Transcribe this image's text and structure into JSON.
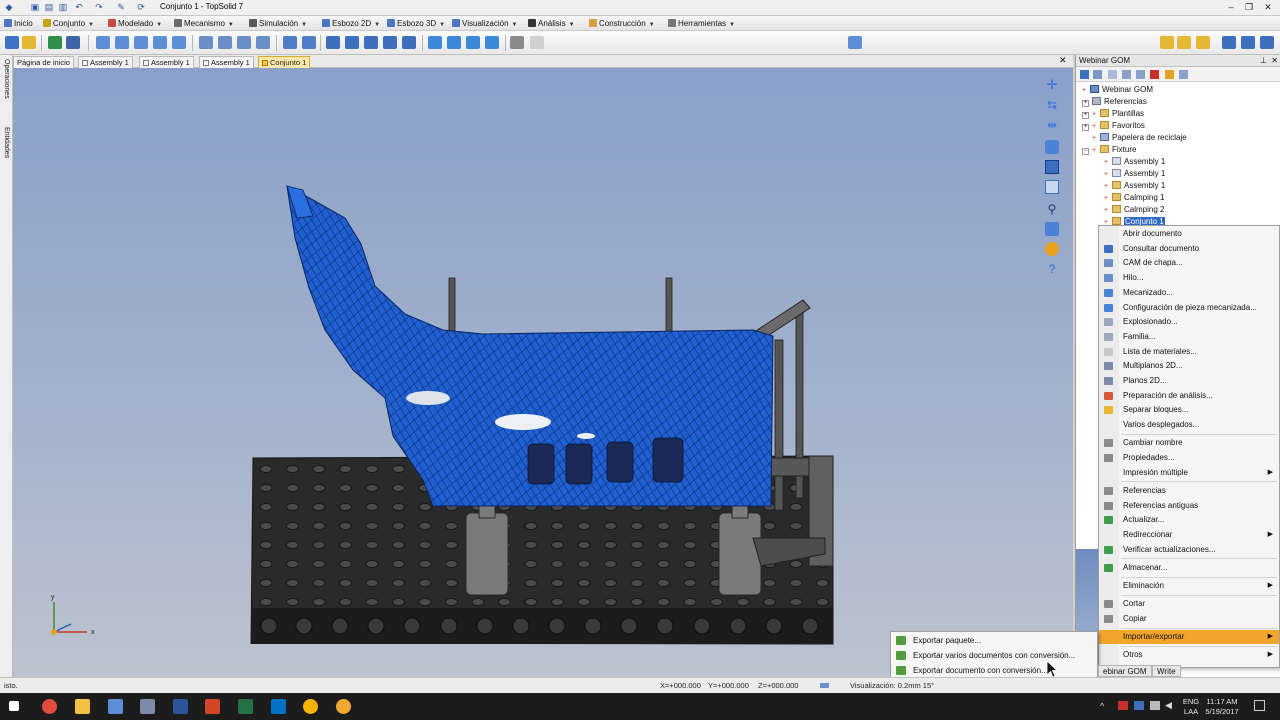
{
  "window": {
    "title": "Conjunto 1 - TopSolid 7"
  },
  "menubar": {
    "items": [
      "Inicio",
      "Conjunto",
      "Modelado",
      "Mecanismo",
      "Simulación",
      "Esbozo 2D",
      "Esbozo 3D",
      "Visualización",
      "Análisis",
      "Construcción",
      "Herramientas"
    ]
  },
  "left_tabs": {
    "operations": "Operaciones",
    "entities": "Entidades"
  },
  "doc_tabs": [
    {
      "label": "Página de inicio",
      "active": false
    },
    {
      "label": "Assembly 1",
      "active": false
    },
    {
      "label": "Assembly 1",
      "active": false
    },
    {
      "label": "Assembly 1",
      "active": false
    },
    {
      "label": "Conjunto 1",
      "active": true
    }
  ],
  "axis": {
    "x": "x",
    "y": "y"
  },
  "panel": {
    "title": "Webinar GOM",
    "tree": [
      {
        "label": "Webinar GOM",
        "level": 0,
        "icon": "project-icon"
      },
      {
        "label": "Referencias",
        "level": 0,
        "icon": "folder-icon"
      },
      {
        "label": "Plantillas",
        "level": 1,
        "icon": "folder-icon"
      },
      {
        "label": "Favoritos",
        "level": 1,
        "icon": "folder-icon"
      },
      {
        "label": "Papelera de reciclaje",
        "level": 1,
        "icon": "recycle-icon"
      },
      {
        "label": "Fixture",
        "level": 1,
        "icon": "folder-icon"
      },
      {
        "label": "Assembly 1",
        "level": 2,
        "icon": "assembly-icon"
      },
      {
        "label": "Assembly 1",
        "level": 2,
        "icon": "assembly-icon"
      },
      {
        "label": "Assembly 1",
        "level": 2,
        "icon": "assembly-icon"
      },
      {
        "label": "Calmping 1",
        "level": 2,
        "icon": "assembly-icon"
      },
      {
        "label": "Calmping 2",
        "level": 2,
        "icon": "assembly-icon"
      },
      {
        "label": "Conjunto 1",
        "level": 2,
        "icon": "assembly-icon",
        "selected": true
      }
    ]
  },
  "context_menu": {
    "items": [
      {
        "label": "Abrir documento",
        "submenu": false
      },
      {
        "label": "Consultar documento",
        "submenu": false
      },
      {
        "label": "CAM de chapa...",
        "submenu": false
      },
      {
        "label": "Hilo...",
        "submenu": false
      },
      {
        "label": "Mecanizado...",
        "submenu": false
      },
      {
        "label": "Configuración de pieza mecanizada...",
        "submenu": false
      },
      {
        "label": "Explosionado...",
        "submenu": false
      },
      {
        "label": "Familia...",
        "submenu": false
      },
      {
        "label": "Lista de materiales...",
        "submenu": false
      },
      {
        "label": "Multiplanos 2D...",
        "submenu": false
      },
      {
        "label": "Planos 2D...",
        "submenu": false
      },
      {
        "label": "Preparación de análisis...",
        "submenu": false
      },
      {
        "label": "Separar bloques...",
        "submenu": false
      },
      {
        "label": "Varios desplegados...",
        "submenu": false
      },
      {
        "label": "Cambiar nombre",
        "submenu": false
      },
      {
        "label": "Propiedades...",
        "submenu": false
      },
      {
        "label": "Impresión múltiple",
        "submenu": true
      },
      {
        "label": "Referencias",
        "submenu": false
      },
      {
        "label": "Referencias antiguas",
        "submenu": false
      },
      {
        "label": "Actualizar...",
        "submenu": false
      },
      {
        "label": "Redireccionar",
        "submenu": true
      },
      {
        "label": "Verificar actualizaciones...",
        "submenu": false
      },
      {
        "label": "Almacenar...",
        "submenu": false
      },
      {
        "label": "Eliminación",
        "submenu": true
      },
      {
        "label": "Cortar",
        "submenu": false
      },
      {
        "label": "Copiar",
        "submenu": false
      },
      {
        "label": "Importar/exportar",
        "submenu": true,
        "highlighted": true
      },
      {
        "label": "Otros",
        "submenu": true
      }
    ],
    "highlight_color": "#f2a52a"
  },
  "submenu": {
    "items": [
      "Exportar paquete...",
      "Exportar varios documentos con conversión...",
      "Exportar documento con conversión..."
    ]
  },
  "bottom_tabs": [
    "ebinar GOM",
    "Write"
  ],
  "statusbar": {
    "left": "isto.",
    "x": "X=+000.000",
    "y": "Y=+000.000",
    "z": "Z=+000.000",
    "visualization": "Visualización: 0.2mm 15°"
  },
  "taskbar": {
    "language": "ENG",
    "region": "LAA",
    "time": "11:17 AM",
    "date": "5/19/2017"
  },
  "colors": {
    "accent_active_tab": "#ffe9a8",
    "mesh_blue": "#1e5fd0",
    "background_top": "#8aa0c9"
  }
}
